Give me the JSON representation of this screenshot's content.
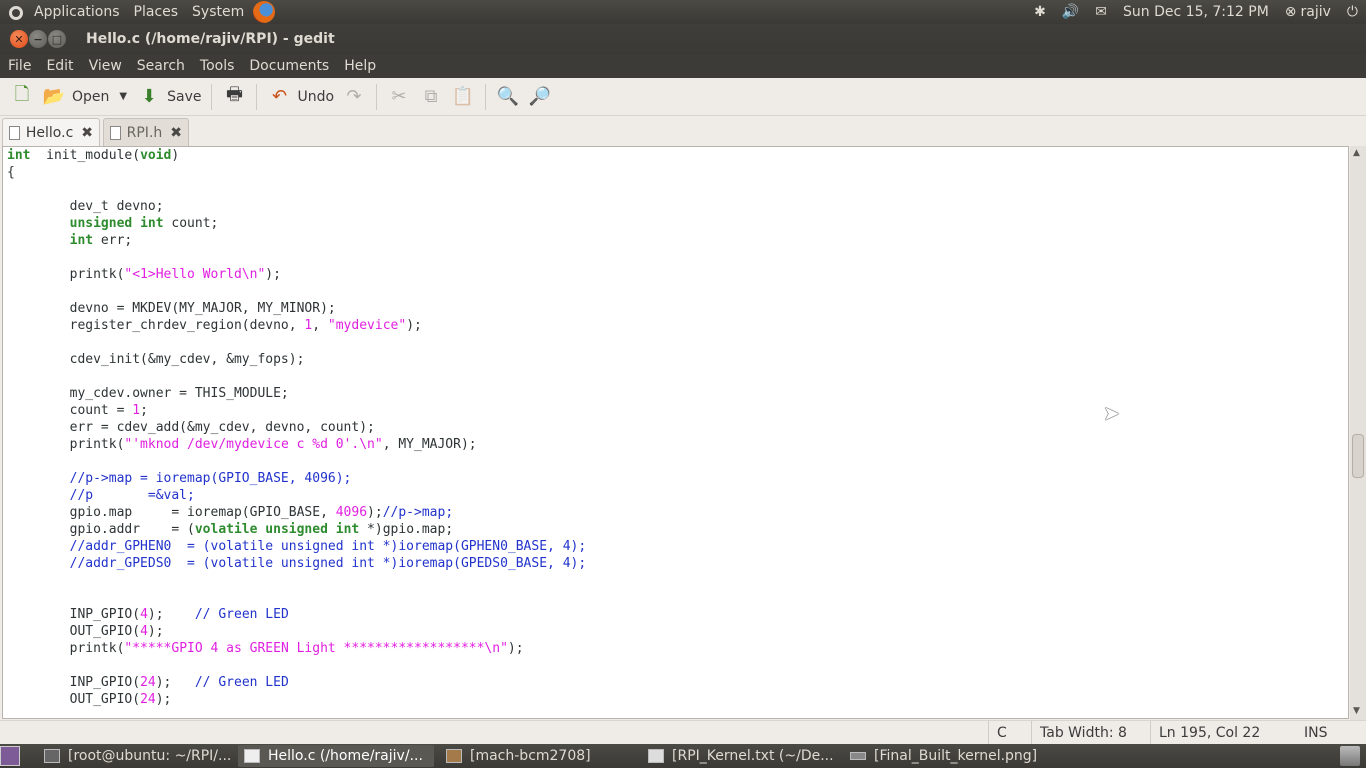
{
  "top_panel": {
    "menus": [
      "Applications",
      "Places",
      "System"
    ],
    "datetime": "Sun Dec 15,  7:12 PM",
    "user": "rajiv"
  },
  "window": {
    "title": "Hello.c (/home/rajiv/RPI) - gedit"
  },
  "menubar": [
    "File",
    "Edit",
    "View",
    "Search",
    "Tools",
    "Documents",
    "Help"
  ],
  "toolbar": {
    "open_label": "Open",
    "save_label": "Save",
    "undo_label": "Undo"
  },
  "tabs": [
    {
      "label": "Hello.c",
      "active": true
    },
    {
      "label": "RPI.h",
      "active": false
    }
  ],
  "code_lines": [
    [
      [
        "kw",
        "int"
      ],
      [
        "",
        "  init_module("
      ],
      [
        "kw",
        "void"
      ],
      [
        "",
        ")"
      ]
    ],
    [
      [
        "",
        "{"
      ]
    ],
    [],
    [
      [
        "",
        "        dev_t devno;"
      ]
    ],
    [
      [
        "",
        "        "
      ],
      [
        "kw",
        "unsigned"
      ],
      [
        "",
        " "
      ],
      [
        "kw",
        "int"
      ],
      [
        "",
        " count;"
      ]
    ],
    [
      [
        "",
        "        "
      ],
      [
        "kw",
        "int"
      ],
      [
        "",
        " err;"
      ]
    ],
    [],
    [
      [
        "",
        "        printk("
      ],
      [
        "st",
        "\"<1>Hello World\\n\""
      ],
      [
        "",
        ");"
      ]
    ],
    [],
    [
      [
        "",
        "        devno = MKDEV(MY_MAJOR, MY_MINOR);"
      ]
    ],
    [
      [
        "",
        "        register_chrdev_region(devno, "
      ],
      [
        "nm",
        "1"
      ],
      [
        "",
        ", "
      ],
      [
        "st",
        "\"mydevice\""
      ],
      [
        "",
        ");"
      ]
    ],
    [],
    [
      [
        "",
        "        cdev_init(&my_cdev, &my_fops);"
      ]
    ],
    [],
    [
      [
        "",
        "        my_cdev.owner = THIS_MODULE;"
      ]
    ],
    [
      [
        "",
        "        count = "
      ],
      [
        "nm",
        "1"
      ],
      [
        "",
        ";"
      ]
    ],
    [
      [
        "",
        "        err = cdev_add(&my_cdev, devno, count);"
      ]
    ],
    [
      [
        "",
        "        printk("
      ],
      [
        "st",
        "\"'mknod /dev/mydevice c %d 0'.\\n\""
      ],
      [
        "",
        ", MY_MAJOR);"
      ]
    ],
    [],
    [
      [
        "cm",
        "        //p->map = ioremap(GPIO_BASE, 4096);"
      ]
    ],
    [
      [
        "cm",
        "        //p       =&val;"
      ]
    ],
    [
      [
        "",
        "        gpio.map     = ioremap(GPIO_BASE, "
      ],
      [
        "nm",
        "4096"
      ],
      [
        "",
        ");"
      ],
      [
        "cm",
        "//p->map;"
      ]
    ],
    [
      [
        "",
        "        gpio.addr    = ("
      ],
      [
        "kw",
        "volatile"
      ],
      [
        "",
        " "
      ],
      [
        "kw",
        "unsigned"
      ],
      [
        "",
        " "
      ],
      [
        "kw",
        "int"
      ],
      [
        "",
        " *)gpio.map;"
      ]
    ],
    [
      [
        "cm",
        "        //addr_GPHEN0  = (volatile unsigned int *)ioremap(GPHEN0_BASE, 4);"
      ]
    ],
    [
      [
        "cm",
        "        //addr_GPEDS0  = (volatile unsigned int *)ioremap(GPEDS0_BASE, 4);"
      ]
    ],
    [],
    [],
    [
      [
        "",
        "        INP_GPIO("
      ],
      [
        "nm",
        "4"
      ],
      [
        "",
        ");    "
      ],
      [
        "cm",
        "// Green LED"
      ]
    ],
    [
      [
        "",
        "        OUT_GPIO("
      ],
      [
        "nm",
        "4"
      ],
      [
        "",
        ");"
      ]
    ],
    [
      [
        "",
        "        printk("
      ],
      [
        "st",
        "\"*****GPIO 4 as GREEN Light ******************\\n\""
      ],
      [
        "",
        ");"
      ]
    ],
    [],
    [
      [
        "",
        "        INP_GPIO("
      ],
      [
        "nm",
        "24"
      ],
      [
        "",
        ");   "
      ],
      [
        "cm",
        "// Green LED"
      ]
    ],
    [
      [
        "",
        "        OUT_GPIO("
      ],
      [
        "nm",
        "24"
      ],
      [
        "",
        ");"
      ]
    ]
  ],
  "statusbar": {
    "language": "C",
    "tab_width": "Tab Width: 8",
    "position": "Ln 195, Col 22",
    "mode": "INS"
  },
  "taskbar": [
    {
      "label": "[root@ubuntu: ~/RPI/...",
      "active": false
    },
    {
      "label": "Hello.c (/home/rajiv/...",
      "active": true
    },
    {
      "label": "[mach-bcm2708]",
      "active": false
    },
    {
      "label": "[RPI_Kernel.txt (~/De...",
      "active": false
    },
    {
      "label": "[Final_Built_kernel.png]",
      "active": false
    }
  ]
}
